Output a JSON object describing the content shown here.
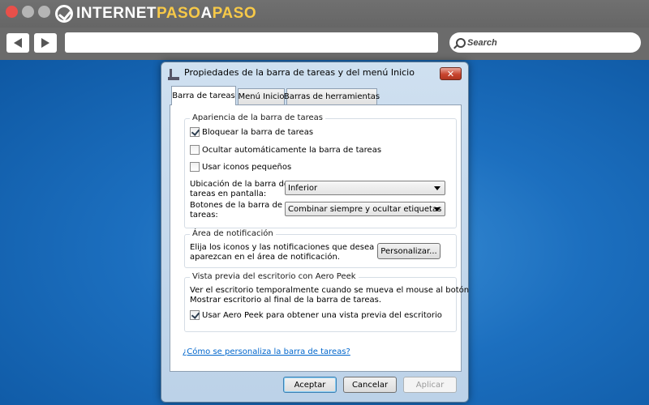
{
  "browser": {
    "logo_text_main": "INTERNET",
    "logo_text_accent": "PASO",
    "logo_text_mid": "A",
    "logo_text_end": "PASO",
    "search_placeholder": "Search"
  },
  "dialog": {
    "title": "Propiedades de la barra de tareas y del menú Inicio",
    "close_label": "✕",
    "tabs": [
      {
        "label": "Barra de tareas",
        "active": true
      },
      {
        "label": "Menú Inicio",
        "active": false
      },
      {
        "label": "Barras de herramientas",
        "active": false
      }
    ],
    "appearance": {
      "title": "Apariencia de la barra de tareas",
      "checkboxes": [
        {
          "label": "Bloquear la barra de tareas",
          "checked": true
        },
        {
          "label": "Ocultar automáticamente la barra de tareas",
          "checked": false
        },
        {
          "label": "Usar iconos pequeños",
          "checked": false
        }
      ],
      "location_label_1": "Ubicación de la barra de",
      "location_label_2": "tareas en pantalla:",
      "location_value": "Inferior",
      "buttons_label_1": "Botones de la barra de",
      "buttons_label_2": "tareas:",
      "buttons_value": "Combinar siempre y ocultar etiquetas"
    },
    "notification": {
      "title": "Área de notificación",
      "text_1": "Elija los iconos y las notificaciones que desea que",
      "text_2": "aparezcan en el área de notificación.",
      "customize_button": "Personalizar..."
    },
    "aero_peek": {
      "title": "Vista previa del escritorio con Aero Peek",
      "text_1": "Ver el escritorio temporalmente cuando se mueva el mouse al botón",
      "text_2": "Mostrar escritorio al final de la barra de tareas.",
      "checkbox_label": "Usar Aero Peek para obtener una vista previa del escritorio",
      "checked": true
    },
    "help_link": "¿Cómo se personaliza la barra de tareas?",
    "footer": {
      "ok": "Aceptar",
      "cancel": "Cancelar",
      "apply": "Aplicar"
    }
  }
}
